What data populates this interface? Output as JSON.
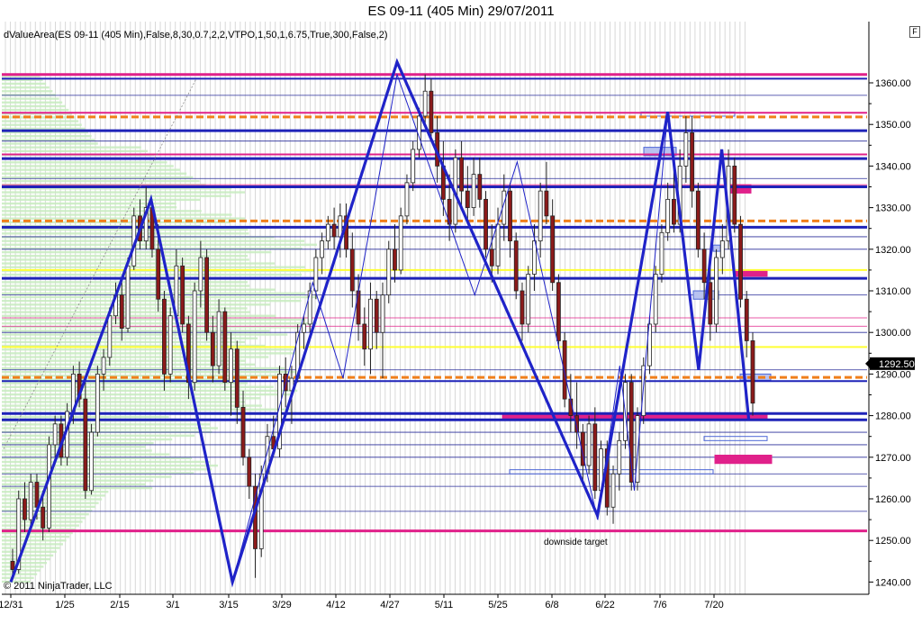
{
  "title": "ES 09-11 (405 Min)  29/07/2011",
  "subtitle": "dValueArea(ES 09-11 (405 Min),False,8,30,0.7,2,2,VTPO,1,50,1,6.75,True,300,False,2)",
  "copyright": "© 2011 NinjaTrader, LLC",
  "annotation": "downside target",
  "toolbar_button": "F",
  "chart_data": {
    "type": "candlestick",
    "x_tick_labels": [
      "12/31",
      "1/25",
      "2/15",
      "3/1",
      "3/15",
      "3/29",
      "4/12",
      "4/27",
      "5/11",
      "5/25",
      "6/8",
      "6/22",
      "7/6",
      "7/20"
    ],
    "y_tick_labels": [
      "1240.00",
      "1250.00",
      "1260.00",
      "1270.00",
      "1280.00",
      "1290.00",
      "1300.00",
      "1310.00",
      "1320.00",
      "1330.00",
      "1340.00",
      "1350.00",
      "1360.00"
    ],
    "ylim": [
      1237,
      1366
    ],
    "last_price": "1292.50",
    "horizontal_levels": [
      {
        "price": 1362.0,
        "color": "#e0218a",
        "style": "solid-thick"
      },
      {
        "price": 1361.0,
        "color": "#1f23b8",
        "style": "solid"
      },
      {
        "price": 1352.8,
        "color": "#e0218a",
        "style": "solid"
      },
      {
        "price": 1351.8,
        "color": "#f07f1a",
        "style": "dashed"
      },
      {
        "price": 1348.5,
        "color": "#1f23b8",
        "style": "solid-thick"
      },
      {
        "price": 1342.8,
        "color": "#e0218a",
        "style": "solid"
      },
      {
        "price": 1341.8,
        "color": "#1f23b8",
        "style": "solid-thick"
      },
      {
        "price": 1335.0,
        "color": "#1f23b8",
        "style": "solid-thick"
      },
      {
        "price": 1326.8,
        "color": "#f07f1a",
        "style": "dashed"
      },
      {
        "price": 1325.3,
        "color": "#1f23b8",
        "style": "solid-thick"
      },
      {
        "price": 1315.0,
        "color": "#ffff33",
        "style": "solid"
      },
      {
        "price": 1313.0,
        "color": "#1f23b8",
        "style": "solid-thick"
      },
      {
        "price": 1296.5,
        "color": "#ffff33",
        "style": "solid"
      },
      {
        "price": 1289.2,
        "color": "#f07f1a",
        "style": "dashed"
      },
      {
        "price": 1288.3,
        "color": "#1f23b8",
        "style": "solid"
      },
      {
        "price": 1280.5,
        "color": "#1f23b8",
        "style": "solid-thick"
      },
      {
        "price": 1279.0,
        "color": "#1f23b8",
        "style": "solid-thick"
      },
      {
        "price": 1252.3,
        "color": "#e0218a",
        "style": "solid-thick"
      }
    ],
    "zigzag_major": [
      {
        "date": "12/31",
        "price": 1240
      },
      {
        "date": "2/25",
        "price": 1332
      },
      {
        "date": "3/16",
        "price": 1240
      },
      {
        "date": "4/29",
        "price": 1365
      },
      {
        "date": "6/20",
        "price": 1256
      },
      {
        "date": "7/8",
        "price": 1353
      },
      {
        "date": "7/16",
        "price": 1291
      },
      {
        "date": "7/22",
        "price": 1344
      },
      {
        "date": "7/29",
        "price": 1279
      }
    ],
    "zigzag_minor": [
      {
        "date": "3/16",
        "price": 1240
      },
      {
        "date": "4/6",
        "price": 1312
      },
      {
        "date": "4/14",
        "price": 1289
      },
      {
        "date": "4/29",
        "price": 1362
      },
      {
        "date": "5/19",
        "price": 1309
      },
      {
        "date": "5/30",
        "price": 1341
      },
      {
        "date": "6/20",
        "price": 1255
      },
      {
        "date": "6/26",
        "price": 1292
      },
      {
        "date": "6/30",
        "price": 1262
      },
      {
        "date": "7/8",
        "price": 1353
      }
    ],
    "candles": [
      {
        "o": 1245,
        "h": 1248,
        "l": 1241,
        "c": 1243
      },
      {
        "o": 1243,
        "h": 1262,
        "l": 1242,
        "c": 1260
      },
      {
        "o": 1260,
        "h": 1264,
        "l": 1252,
        "c": 1255
      },
      {
        "o": 1255,
        "h": 1266,
        "l": 1253,
        "c": 1264
      },
      {
        "o": 1264,
        "h": 1266,
        "l": 1255,
        "c": 1258
      },
      {
        "o": 1258,
        "h": 1262,
        "l": 1250,
        "c": 1253
      },
      {
        "o": 1253,
        "h": 1275,
        "l": 1252,
        "c": 1273
      },
      {
        "o": 1273,
        "h": 1280,
        "l": 1270,
        "c": 1278
      },
      {
        "o": 1278,
        "h": 1280,
        "l": 1268,
        "c": 1270
      },
      {
        "o": 1270,
        "h": 1283,
        "l": 1268,
        "c": 1281
      },
      {
        "o": 1281,
        "h": 1292,
        "l": 1278,
        "c": 1290
      },
      {
        "o": 1290,
        "h": 1293,
        "l": 1282,
        "c": 1284
      },
      {
        "o": 1284,
        "h": 1288,
        "l": 1260,
        "c": 1262
      },
      {
        "o": 1262,
        "h": 1278,
        "l": 1261,
        "c": 1276
      },
      {
        "o": 1276,
        "h": 1292,
        "l": 1275,
        "c": 1290
      },
      {
        "o": 1290,
        "h": 1296,
        "l": 1286,
        "c": 1294
      },
      {
        "o": 1294,
        "h": 1306,
        "l": 1292,
        "c": 1304
      },
      {
        "o": 1304,
        "h": 1312,
        "l": 1302,
        "c": 1309
      },
      {
        "o": 1309,
        "h": 1312,
        "l": 1298,
        "c": 1301
      },
      {
        "o": 1301,
        "h": 1318,
        "l": 1300,
        "c": 1316
      },
      {
        "o": 1316,
        "h": 1330,
        "l": 1315,
        "c": 1328
      },
      {
        "o": 1328,
        "h": 1332,
        "l": 1320,
        "c": 1322
      },
      {
        "o": 1322,
        "h": 1335,
        "l": 1320,
        "c": 1330
      },
      {
        "o": 1330,
        "h": 1332,
        "l": 1318,
        "c": 1320
      },
      {
        "o": 1320,
        "h": 1326,
        "l": 1305,
        "c": 1308
      },
      {
        "o": 1308,
        "h": 1310,
        "l": 1286,
        "c": 1290
      },
      {
        "o": 1290,
        "h": 1306,
        "l": 1288,
        "c": 1304
      },
      {
        "o": 1304,
        "h": 1320,
        "l": 1302,
        "c": 1316
      },
      {
        "o": 1316,
        "h": 1318,
        "l": 1300,
        "c": 1302
      },
      {
        "o": 1302,
        "h": 1304,
        "l": 1284,
        "c": 1288
      },
      {
        "o": 1288,
        "h": 1312,
        "l": 1286,
        "c": 1310
      },
      {
        "o": 1310,
        "h": 1322,
        "l": 1306,
        "c": 1318
      },
      {
        "o": 1318,
        "h": 1320,
        "l": 1298,
        "c": 1300
      },
      {
        "o": 1300,
        "h": 1304,
        "l": 1288,
        "c": 1292
      },
      {
        "o": 1292,
        "h": 1308,
        "l": 1290,
        "c": 1305
      },
      {
        "o": 1305,
        "h": 1306,
        "l": 1286,
        "c": 1288
      },
      {
        "o": 1288,
        "h": 1300,
        "l": 1280,
        "c": 1296
      },
      {
        "o": 1296,
        "h": 1298,
        "l": 1278,
        "c": 1282
      },
      {
        "o": 1282,
        "h": 1286,
        "l": 1268,
        "c": 1270
      },
      {
        "o": 1270,
        "h": 1272,
        "l": 1260,
        "c": 1263
      },
      {
        "o": 1263,
        "h": 1266,
        "l": 1241,
        "c": 1248
      },
      {
        "o": 1248,
        "h": 1268,
        "l": 1246,
        "c": 1266
      },
      {
        "o": 1266,
        "h": 1278,
        "l": 1264,
        "c": 1275
      },
      {
        "o": 1275,
        "h": 1280,
        "l": 1270,
        "c": 1272
      },
      {
        "o": 1272,
        "h": 1292,
        "l": 1270,
        "c": 1290
      },
      {
        "o": 1290,
        "h": 1294,
        "l": 1282,
        "c": 1286
      },
      {
        "o": 1286,
        "h": 1292,
        "l": 1278,
        "c": 1289
      },
      {
        "o": 1289,
        "h": 1302,
        "l": 1288,
        "c": 1300
      },
      {
        "o": 1300,
        "h": 1304,
        "l": 1296,
        "c": 1302
      },
      {
        "o": 1302,
        "h": 1312,
        "l": 1300,
        "c": 1310
      },
      {
        "o": 1310,
        "h": 1320,
        "l": 1308,
        "c": 1318
      },
      {
        "o": 1318,
        "h": 1324,
        "l": 1314,
        "c": 1322
      },
      {
        "o": 1322,
        "h": 1328,
        "l": 1320,
        "c": 1326
      },
      {
        "o": 1326,
        "h": 1330,
        "l": 1320,
        "c": 1323
      },
      {
        "o": 1323,
        "h": 1331,
        "l": 1318,
        "c": 1328
      },
      {
        "o": 1328,
        "h": 1331,
        "l": 1318,
        "c": 1320
      },
      {
        "o": 1320,
        "h": 1324,
        "l": 1306,
        "c": 1310
      },
      {
        "o": 1310,
        "h": 1314,
        "l": 1298,
        "c": 1302
      },
      {
        "o": 1302,
        "h": 1306,
        "l": 1292,
        "c": 1296
      },
      {
        "o": 1296,
        "h": 1312,
        "l": 1290,
        "c": 1308
      },
      {
        "o": 1308,
        "h": 1310,
        "l": 1296,
        "c": 1300
      },
      {
        "o": 1300,
        "h": 1312,
        "l": 1289,
        "c": 1309
      },
      {
        "o": 1309,
        "h": 1322,
        "l": 1307,
        "c": 1320
      },
      {
        "o": 1320,
        "h": 1326,
        "l": 1312,
        "c": 1315
      },
      {
        "o": 1315,
        "h": 1330,
        "l": 1314,
        "c": 1328
      },
      {
        "o": 1328,
        "h": 1338,
        "l": 1326,
        "c": 1336
      },
      {
        "o": 1336,
        "h": 1346,
        "l": 1334,
        "c": 1344
      },
      {
        "o": 1344,
        "h": 1354,
        "l": 1342,
        "c": 1352
      },
      {
        "o": 1352,
        "h": 1362,
        "l": 1350,
        "c": 1358
      },
      {
        "o": 1358,
        "h": 1361,
        "l": 1346,
        "c": 1348
      },
      {
        "o": 1348,
        "h": 1352,
        "l": 1336,
        "c": 1340
      },
      {
        "o": 1340,
        "h": 1346,
        "l": 1328,
        "c": 1332
      },
      {
        "o": 1332,
        "h": 1338,
        "l": 1322,
        "c": 1326
      },
      {
        "o": 1326,
        "h": 1344,
        "l": 1324,
        "c": 1342
      },
      {
        "o": 1342,
        "h": 1346,
        "l": 1330,
        "c": 1334
      },
      {
        "o": 1334,
        "h": 1340,
        "l": 1326,
        "c": 1330
      },
      {
        "o": 1330,
        "h": 1342,
        "l": 1328,
        "c": 1338
      },
      {
        "o": 1338,
        "h": 1342,
        "l": 1330,
        "c": 1332
      },
      {
        "o": 1332,
        "h": 1334,
        "l": 1318,
        "c": 1320
      },
      {
        "o": 1320,
        "h": 1326,
        "l": 1312,
        "c": 1316
      },
      {
        "o": 1316,
        "h": 1330,
        "l": 1314,
        "c": 1326
      },
      {
        "o": 1326,
        "h": 1338,
        "l": 1322,
        "c": 1334
      },
      {
        "o": 1334,
        "h": 1336,
        "l": 1318,
        "c": 1322
      },
      {
        "o": 1322,
        "h": 1324,
        "l": 1308,
        "c": 1310
      },
      {
        "o": 1310,
        "h": 1312,
        "l": 1298,
        "c": 1302
      },
      {
        "o": 1302,
        "h": 1316,
        "l": 1300,
        "c": 1314
      },
      {
        "o": 1314,
        "h": 1326,
        "l": 1310,
        "c": 1322
      },
      {
        "o": 1322,
        "h": 1336,
        "l": 1318,
        "c": 1334
      },
      {
        "o": 1334,
        "h": 1341,
        "l": 1326,
        "c": 1328
      },
      {
        "o": 1328,
        "h": 1332,
        "l": 1310,
        "c": 1312
      },
      {
        "o": 1312,
        "h": 1314,
        "l": 1296,
        "c": 1298
      },
      {
        "o": 1298,
        "h": 1300,
        "l": 1282,
        "c": 1284
      },
      {
        "o": 1284,
        "h": 1290,
        "l": 1276,
        "c": 1280
      },
      {
        "o": 1280,
        "h": 1288,
        "l": 1272,
        "c": 1276
      },
      {
        "o": 1276,
        "h": 1278,
        "l": 1264,
        "c": 1268
      },
      {
        "o": 1268,
        "h": 1280,
        "l": 1266,
        "c": 1278
      },
      {
        "o": 1278,
        "h": 1282,
        "l": 1260,
        "c": 1262
      },
      {
        "o": 1262,
        "h": 1274,
        "l": 1260,
        "c": 1272
      },
      {
        "o": 1272,
        "h": 1274,
        "l": 1256,
        "c": 1258
      },
      {
        "o": 1258,
        "h": 1268,
        "l": 1254,
        "c": 1266
      },
      {
        "o": 1266,
        "h": 1276,
        "l": 1262,
        "c": 1274
      },
      {
        "o": 1274,
        "h": 1290,
        "l": 1272,
        "c": 1288
      },
      {
        "o": 1288,
        "h": 1290,
        "l": 1262,
        "c": 1264
      },
      {
        "o": 1264,
        "h": 1282,
        "l": 1262,
        "c": 1280
      },
      {
        "o": 1280,
        "h": 1294,
        "l": 1278,
        "c": 1292
      },
      {
        "o": 1292,
        "h": 1304,
        "l": 1290,
        "c": 1302
      },
      {
        "o": 1302,
        "h": 1316,
        "l": 1300,
        "c": 1314
      },
      {
        "o": 1314,
        "h": 1326,
        "l": 1312,
        "c": 1324
      },
      {
        "o": 1324,
        "h": 1336,
        "l": 1322,
        "c": 1332
      },
      {
        "o": 1332,
        "h": 1340,
        "l": 1324,
        "c": 1326
      },
      {
        "o": 1326,
        "h": 1344,
        "l": 1324,
        "c": 1340
      },
      {
        "o": 1340,
        "h": 1352,
        "l": 1336,
        "c": 1348
      },
      {
        "o": 1348,
        "h": 1352,
        "l": 1330,
        "c": 1334
      },
      {
        "o": 1334,
        "h": 1336,
        "l": 1318,
        "c": 1320
      },
      {
        "o": 1320,
        "h": 1324,
        "l": 1308,
        "c": 1312
      },
      {
        "o": 1312,
        "h": 1318,
        "l": 1298,
        "c": 1302
      },
      {
        "o": 1302,
        "h": 1320,
        "l": 1300,
        "c": 1318
      },
      {
        "o": 1318,
        "h": 1326,
        "l": 1314,
        "c": 1322
      },
      {
        "o": 1322,
        "h": 1344,
        "l": 1320,
        "c": 1340
      },
      {
        "o": 1340,
        "h": 1342,
        "l": 1324,
        "c": 1326
      },
      {
        "o": 1326,
        "h": 1328,
        "l": 1306,
        "c": 1308
      },
      {
        "o": 1308,
        "h": 1310,
        "l": 1294,
        "c": 1298
      },
      {
        "o": 1298,
        "h": 1300,
        "l": 1280,
        "c": 1283
      }
    ]
  }
}
